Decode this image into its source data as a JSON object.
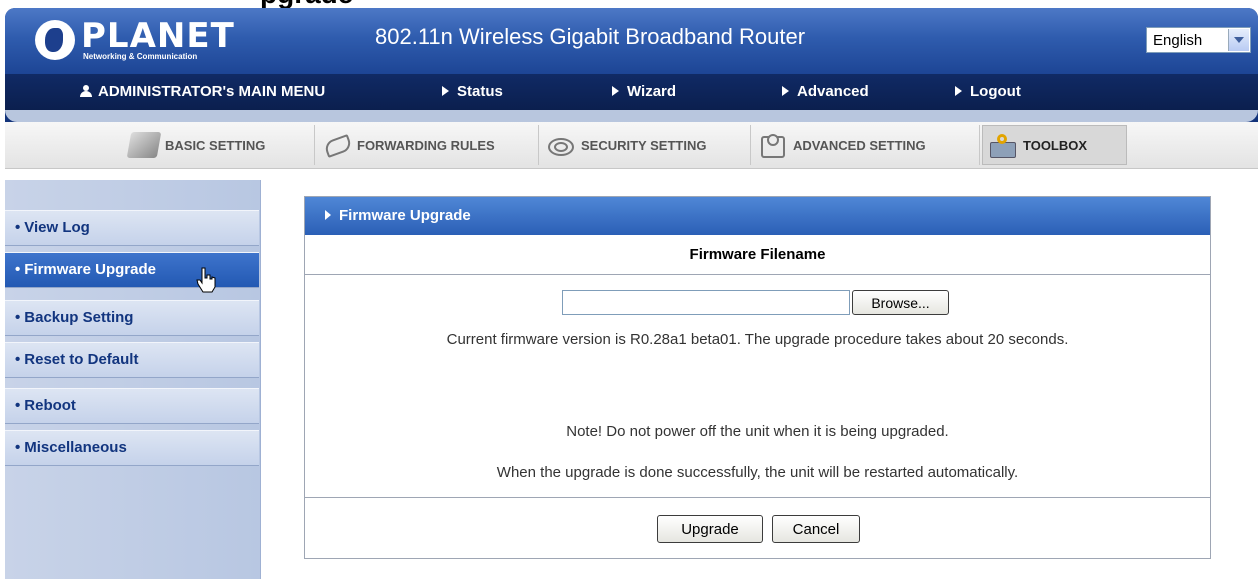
{
  "page_heading_partial": "pgrade",
  "header": {
    "logo_text": "PLANET",
    "logo_subtext": "Networking & Communication",
    "router_title": "802.11n Wireless Gigabit Broadband Router",
    "language": "English"
  },
  "main_menu": {
    "admin_label": "ADMINISTRATOR's MAIN MENU",
    "items": [
      "Status",
      "Wizard",
      "Advanced",
      "Logout"
    ]
  },
  "tabs": [
    {
      "label": "BASIC SETTING",
      "icon": "book-icon"
    },
    {
      "label": "FORWARDING RULES",
      "icon": "forwarding-icon"
    },
    {
      "label": "SECURITY SETTING",
      "icon": "security-icon"
    },
    {
      "label": "ADVANCED SETTING",
      "icon": "advanced-icon"
    },
    {
      "label": "TOOLBOX",
      "icon": "toolbox-icon"
    }
  ],
  "active_tab": "TOOLBOX",
  "sidebar": {
    "items": [
      "View Log",
      "Firmware Upgrade",
      "Backup Setting",
      "Reset to Default",
      "Reboot",
      "Miscellaneous"
    ],
    "active": "Firmware Upgrade"
  },
  "panel": {
    "title": "Firmware Upgrade",
    "filename_label": "Firmware Filename",
    "file_value": "",
    "browse_label": "Browse...",
    "version_text": "Current firmware version is R0.28a1 beta01. The upgrade procedure takes about 20 seconds.",
    "note_text": "Note! Do not power off the unit when it is being upgraded.",
    "restart_text": "When the upgrade is done successfully, the unit will be restarted automatically.",
    "upgrade_label": "Upgrade",
    "cancel_label": "Cancel"
  },
  "colors": {
    "header_blue": "#2f5cae",
    "menu_navy": "#0b1f4e",
    "panel_header": "#3d74c9",
    "sidebar_active": "#2e64bf"
  }
}
